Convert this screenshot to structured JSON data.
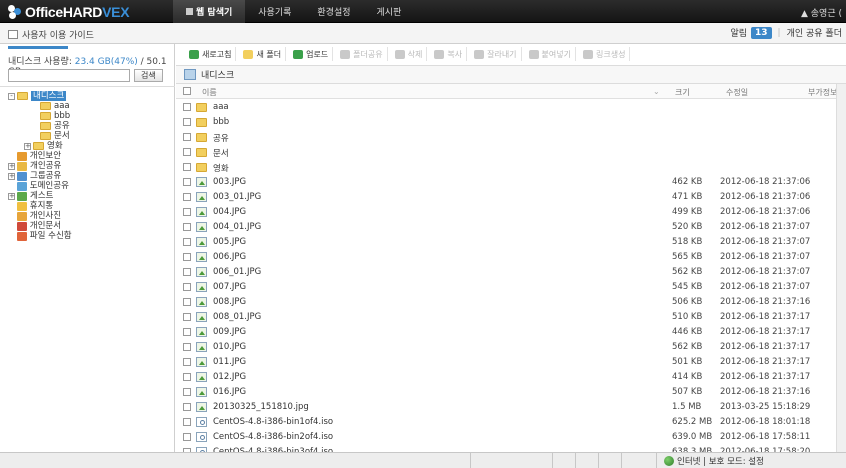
{
  "app": {
    "logo_main": "OfficeHARD",
    "logo_accent": "VEX"
  },
  "nav": {
    "tabs": [
      "웹 탐색기",
      "사용기록",
      "환경설정",
      "게시판"
    ],
    "active": 0,
    "user": "▲ 송영근 ("
  },
  "subbar": {
    "guide": "사용자 이용 가이드",
    "alerts_label": "알림",
    "alerts_count": "13",
    "shared_label": "개인 공유 폴더"
  },
  "left": {
    "usage_prefix": "내디스크 사용량: ",
    "usage_value": "23.4 GB(47%)",
    "usage_total": " / 50.1 GB",
    "search_button": "검색",
    "search_value": "",
    "tree": [
      {
        "label": "내디스크",
        "indent": 0,
        "toggle": "−",
        "icon": "folder",
        "selected": true
      },
      {
        "label": "aaa",
        "indent": 2,
        "toggle": "",
        "icon": "folder"
      },
      {
        "label": "bbb",
        "indent": 2,
        "toggle": "",
        "icon": "folder"
      },
      {
        "label": "공유",
        "indent": 2,
        "toggle": "",
        "icon": "folder"
      },
      {
        "label": "문서",
        "indent": 2,
        "toggle": "",
        "icon": "folder"
      },
      {
        "label": "영화",
        "indent": 1,
        "toggle": "+",
        "icon": "folder"
      },
      {
        "label": "개인보안",
        "indent": 0.55,
        "toggle": "",
        "icon": "lock"
      },
      {
        "label": "개인공유",
        "indent": 0,
        "toggle": "+",
        "icon": "share"
      },
      {
        "label": "그룹공유",
        "indent": 0,
        "toggle": "+",
        "icon": "group"
      },
      {
        "label": "도메인공유",
        "indent": 0.55,
        "toggle": "",
        "icon": "domain"
      },
      {
        "label": "게스트",
        "indent": 0,
        "toggle": "+",
        "icon": "guest"
      },
      {
        "label": "휴지통",
        "indent": 0.55,
        "toggle": "",
        "icon": "trash"
      },
      {
        "label": "개인사진",
        "indent": 0.55,
        "toggle": "",
        "icon": "photo"
      },
      {
        "label": "개인문서",
        "indent": 0.55,
        "toggle": "",
        "icon": "doc"
      },
      {
        "label": "파일 수신함",
        "indent": 0.55,
        "toggle": "",
        "icon": "inbox"
      }
    ]
  },
  "toolbar": [
    {
      "label": "새로고침",
      "enabled": true,
      "color": "#3aa04a"
    },
    {
      "label": "새 폴더",
      "enabled": true,
      "color": "#f2cf5e"
    },
    {
      "label": "업로드",
      "enabled": true,
      "color": "#3aa04a"
    },
    {
      "label": "폴더공유",
      "enabled": false,
      "color": "#c9c9c9"
    },
    {
      "label": "삭제",
      "enabled": false,
      "color": "#c9c9c9"
    },
    {
      "label": "복사",
      "enabled": false,
      "color": "#c9c9c9"
    },
    {
      "label": "잘라내기",
      "enabled": false,
      "color": "#c9c9c9"
    },
    {
      "label": "붙여넣기",
      "enabled": false,
      "color": "#c9c9c9"
    },
    {
      "label": "링크생성",
      "enabled": false,
      "color": "#c9c9c9"
    }
  ],
  "breadcrumb": "내디스크",
  "table": {
    "columns": {
      "name": "이름",
      "size": "크기",
      "modified": "수정일",
      "extra": "부가정보"
    },
    "rows": [
      {
        "name": "aaa",
        "type": "folder",
        "size": "",
        "date": ""
      },
      {
        "name": "bbb",
        "type": "folder",
        "size": "",
        "date": ""
      },
      {
        "name": "공유",
        "type": "folder",
        "size": "",
        "date": ""
      },
      {
        "name": "문서",
        "type": "folder",
        "size": "",
        "date": ""
      },
      {
        "name": "영화",
        "type": "folder",
        "size": "",
        "date": ""
      },
      {
        "name": "003.JPG",
        "type": "image",
        "size": "462 KB",
        "date": "2012-06-18 21:37:06"
      },
      {
        "name": "003_01.JPG",
        "type": "image",
        "size": "471 KB",
        "date": "2012-06-18 21:37:06"
      },
      {
        "name": "004.JPG",
        "type": "image",
        "size": "499 KB",
        "date": "2012-06-18 21:37:06"
      },
      {
        "name": "004_01.JPG",
        "type": "image",
        "size": "520 KB",
        "date": "2012-06-18 21:37:07"
      },
      {
        "name": "005.JPG",
        "type": "image",
        "size": "518 KB",
        "date": "2012-06-18 21:37:07"
      },
      {
        "name": "006.JPG",
        "type": "image",
        "size": "565 KB",
        "date": "2012-06-18 21:37:07"
      },
      {
        "name": "006_01.JPG",
        "type": "image",
        "size": "562 KB",
        "date": "2012-06-18 21:37:07"
      },
      {
        "name": "007.JPG",
        "type": "image",
        "size": "545 KB",
        "date": "2012-06-18 21:37:07"
      },
      {
        "name": "008.JPG",
        "type": "image",
        "size": "506 KB",
        "date": "2012-06-18 21:37:16"
      },
      {
        "name": "008_01.JPG",
        "type": "image",
        "size": "510 KB",
        "date": "2012-06-18 21:37:17"
      },
      {
        "name": "009.JPG",
        "type": "image",
        "size": "446 KB",
        "date": "2012-06-18 21:37:17"
      },
      {
        "name": "010.JPG",
        "type": "image",
        "size": "562 KB",
        "date": "2012-06-18 21:37:17"
      },
      {
        "name": "011.JPG",
        "type": "image",
        "size": "501 KB",
        "date": "2012-06-18 21:37:17"
      },
      {
        "name": "012.JPG",
        "type": "image",
        "size": "414 KB",
        "date": "2012-06-18 21:37:17"
      },
      {
        "name": "016.JPG",
        "type": "image",
        "size": "507 KB",
        "date": "2012-06-18 21:37:16"
      },
      {
        "name": "20130325_151810.jpg",
        "type": "image",
        "size": "1.5 MB",
        "date": "2013-03-25 15:18:29"
      },
      {
        "name": "CentOS-4.8-i386-bin1of4.iso",
        "type": "iso",
        "size": "625.2 MB",
        "date": "2012-06-18 18:01:18"
      },
      {
        "name": "CentOS-4.8-i386-bin2of4.iso",
        "type": "iso",
        "size": "639.0 MB",
        "date": "2012-06-18 17:58:11"
      },
      {
        "name": "CentOS-4.8-i386-bin3of4.iso",
        "type": "iso",
        "size": "638.3 MB",
        "date": "2012-06-18 17:58:20"
      }
    ]
  },
  "statusbar": {
    "zone": "인터넷 | 보호 모드: 설정"
  },
  "colors": {
    "accent": "#3c87c8",
    "topbar": "#1c1c1c",
    "folder": "#f2cf5e"
  }
}
